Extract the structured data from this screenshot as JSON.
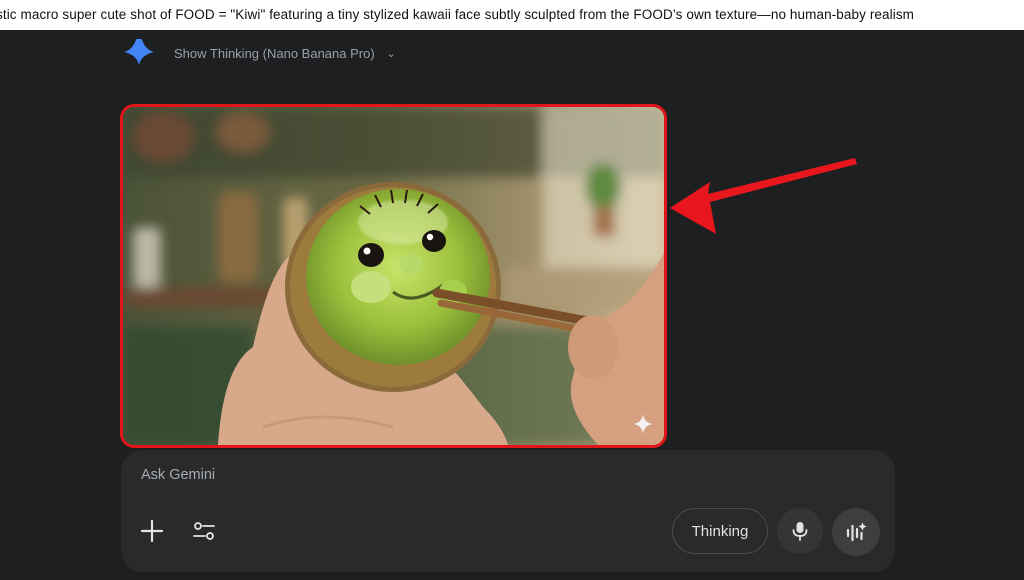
{
  "prompt": {
    "text": "stic macro super cute shot of FOOD = \"Kiwi\" featuring a tiny stylized kawaii face subtly sculpted from the FOOD’s own texture—no human-baby realism"
  },
  "response": {
    "thinking_label": "Show Thinking (Nano Banana Pro)",
    "gemini_icon": "gemini-spark-icon",
    "chevron_icon": "chevron-down-icon"
  },
  "generated_image": {
    "subject": "kiwi-with-kawaii-face-held-by-chopsticks",
    "highlight_color": "#e0161b",
    "sparkle_icon": "sparkle-icon"
  },
  "annotation": {
    "arrow_icon": "red-arrow-icon",
    "arrow_color": "#e8161d"
  },
  "input": {
    "placeholder": "Ask Gemini",
    "plus_icon": "plus-icon",
    "tools_icon": "tools-sliders-icon",
    "mode_label": "Thinking",
    "mic_icon": "microphone-icon",
    "live_icon": "live-waveform-icon"
  },
  "colors": {
    "background": "#1e1f20",
    "panel": "#282a2c",
    "accent": "#4285f4"
  }
}
